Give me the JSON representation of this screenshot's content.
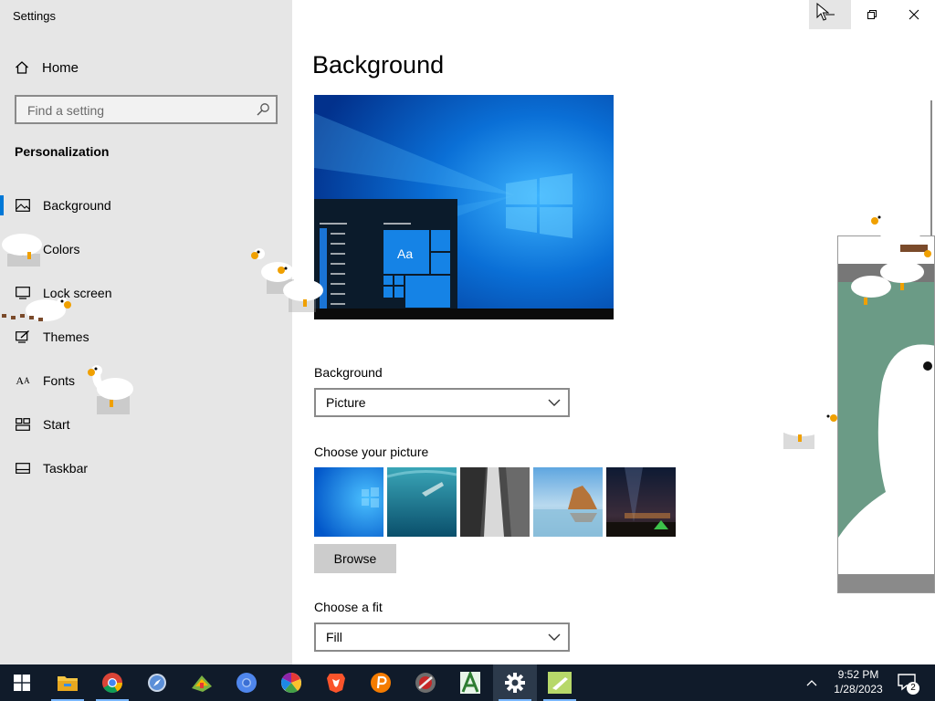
{
  "window": {
    "title": "Settings",
    "controls": {
      "minimize": "minimize",
      "maximize": "restore",
      "close": "close"
    }
  },
  "sidebar": {
    "home_label": "Home",
    "search_placeholder": "Find a setting",
    "section_title": "Personalization",
    "items": [
      {
        "label": "Background",
        "icon": "picture-icon",
        "active": true
      },
      {
        "label": "Colors",
        "icon": "palette-icon",
        "active": false
      },
      {
        "label": "Lock screen",
        "icon": "lock-screen-icon",
        "active": false
      },
      {
        "label": "Themes",
        "icon": "brush-icon",
        "active": false
      },
      {
        "label": "Fonts",
        "icon": "font-icon",
        "active": false
      },
      {
        "label": "Start",
        "icon": "start-menu-icon",
        "active": false
      },
      {
        "label": "Taskbar",
        "icon": "taskbar-icon",
        "active": false
      }
    ]
  },
  "main": {
    "title": "Background",
    "preview_sample_text": "Aa",
    "background_label": "Background",
    "background_value": "Picture",
    "choose_picture_label": "Choose your picture",
    "pictures": [
      "windows-blue",
      "underwater-swimmer",
      "waterfall-cliff",
      "beach-rock",
      "night-sky-tent"
    ],
    "browse_label": "Browse",
    "fit_label": "Choose a fit",
    "fit_value": "Fill"
  },
  "taskbar": {
    "apps": [
      {
        "name": "file-explorer-icon",
        "running": true
      },
      {
        "name": "chrome-icon",
        "running": true
      },
      {
        "name": "safari-icon",
        "running": false
      },
      {
        "name": "game-icon",
        "running": false
      },
      {
        "name": "chromium-icon",
        "running": false
      },
      {
        "name": "photos-icon",
        "running": false
      },
      {
        "name": "brave-icon",
        "running": false
      },
      {
        "name": "p-app-icon",
        "running": false
      },
      {
        "name": "media-player-icon",
        "running": false
      },
      {
        "name": "a-app-icon",
        "running": false
      },
      {
        "name": "settings-icon",
        "running": true,
        "active": true
      },
      {
        "name": "goose-icon",
        "running": true
      }
    ],
    "time": "9:52 PM",
    "date": "1/28/2023",
    "notification_count": "2"
  },
  "colors": {
    "accent": "#0078d7",
    "taskbar": "#101b2a",
    "sidebar": "#e6e6e6"
  }
}
